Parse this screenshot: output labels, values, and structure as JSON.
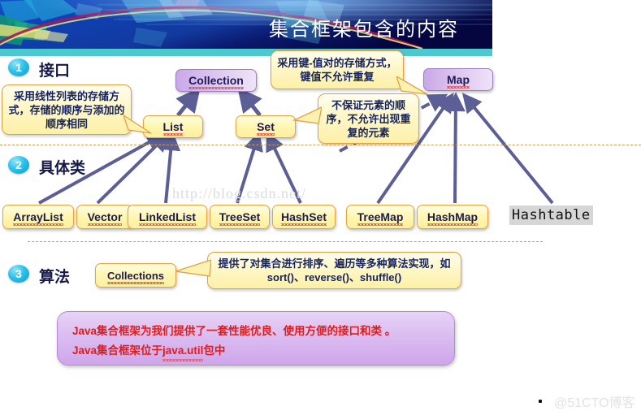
{
  "banner": {
    "title": "集合框架包含的内容",
    "art_name": "blue-abstract-geometry",
    "accent_color": "#0a1060",
    "strip_color": "#4cc9cf"
  },
  "sections": [
    {
      "number": "1",
      "label": "接口"
    },
    {
      "number": "2",
      "label": "具体类"
    },
    {
      "number": "3",
      "label": "算法"
    }
  ],
  "interfaces": [
    {
      "name": "Collection",
      "style": "purple"
    },
    {
      "name": "List",
      "style": "yellow"
    },
    {
      "name": "Set",
      "style": "yellow"
    },
    {
      "name": "Map",
      "style": "purple"
    }
  ],
  "classes": [
    {
      "name": "ArrayList"
    },
    {
      "name": "Vector"
    },
    {
      "name": "LinkedList"
    },
    {
      "name": "TreeSet"
    },
    {
      "name": "HashSet"
    },
    {
      "name": "TreeMap"
    },
    {
      "name": "HashMap"
    }
  ],
  "hashtable": {
    "name": "Hashtable"
  },
  "algorithms": {
    "node": "Collections",
    "callout": "提供了对集合进行排序、遍历等多种算法实现，如 sort()、reverse()、shuffle()"
  },
  "callouts": {
    "list": "采用线性列表的存储方式，存储的顺序与添加的顺序相同",
    "map": "采用键-值对的存储方式，键值不允许重复",
    "set": "不保证元素的顺序，不允许出现重复的元素"
  },
  "summary": {
    "line1_a": "Java",
    "line1_b": "集合框架为我们提供了一套性能优良、使用方便的接口和类 。",
    "line2_a": "Java",
    "line2_b": "集合框架位于",
    "line2_c": "java.util",
    "line2_d": "包中",
    "text_color": "#e01b1b"
  },
  "watermarks": {
    "center": "http://blog.csdn.net/",
    "corner": "@51CTO博客"
  }
}
